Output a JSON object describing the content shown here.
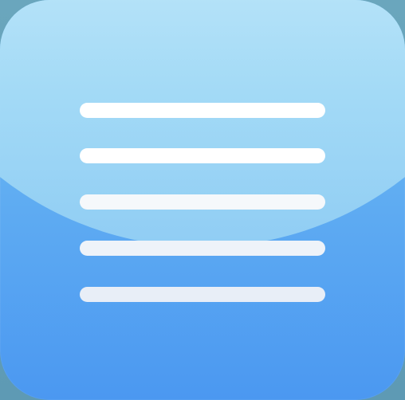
{
  "icon": {
    "name": "menu-list-icon",
    "line_count": 5
  },
  "colors": {
    "background": "#6f9fb6",
    "icon_top": "#7cc3f6",
    "icon_bottom": "#4b98f1",
    "gloss": "#dff6ff",
    "lines": "#ffffff"
  }
}
